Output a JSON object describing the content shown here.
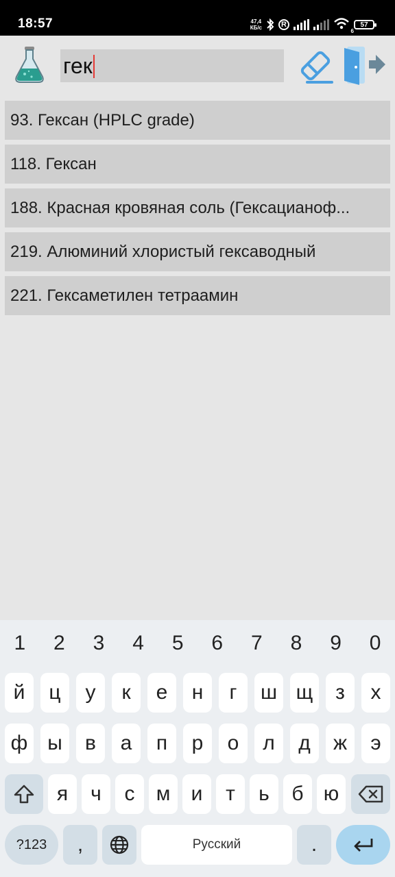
{
  "status_bar": {
    "time": "18:57",
    "network_speed_top": "47,4",
    "network_speed_bottom": "КБ/с",
    "registered_icon": "R",
    "battery": "57",
    "wifi_badge": "6"
  },
  "toolbar": {
    "logo_icon": "flask-icon",
    "search_value": "гек",
    "clear_icon": "eraser-icon",
    "exit_icon": "exit-door-icon"
  },
  "results": [
    "93. Гексан (HPLC grade)",
    "118. Гексан",
    "188. Красная кровяная соль (Гексацианоф...",
    "219. Алюминий хлористый гексаводный",
    "221. Гексаметилен тетраамин"
  ],
  "keyboard": {
    "numbers": [
      "1",
      "2",
      "3",
      "4",
      "5",
      "6",
      "7",
      "8",
      "9",
      "0"
    ],
    "row1": [
      "й",
      "ц",
      "у",
      "к",
      "е",
      "н",
      "г",
      "ш",
      "щ",
      "з",
      "х"
    ],
    "row2": [
      "ф",
      "ы",
      "в",
      "а",
      "п",
      "р",
      "о",
      "л",
      "д",
      "ж",
      "э"
    ],
    "row3": [
      "я",
      "ч",
      "с",
      "м",
      "и",
      "т",
      "ь",
      "б",
      "ю"
    ],
    "symbols_label": "?123",
    "comma_label": ",",
    "space_label": "Русский",
    "period_label": "."
  },
  "colors": {
    "accent_blue": "#4a9fe0",
    "caret": "#e53935",
    "row_background": "#cfcfcf",
    "page_background": "#e6e6e6"
  }
}
